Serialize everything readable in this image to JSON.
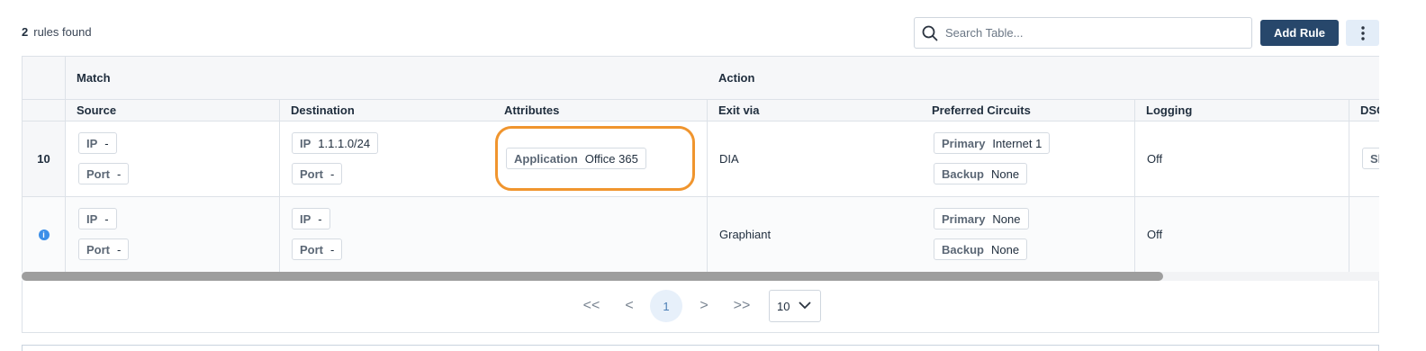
{
  "summary": {
    "count": "2",
    "label": "rules found"
  },
  "toolbar": {
    "search_placeholder": "Search Table...",
    "add_label": "Add Rule"
  },
  "table": {
    "group_headers": {
      "match": "Match",
      "action": "Action"
    },
    "columns": {
      "source": "Source",
      "destination": "Destination",
      "attributes": "Attributes",
      "exit_via": "Exit via",
      "preferred_circuits": "Preferred Circuits",
      "logging": "Logging",
      "dscp": "DSC"
    },
    "rows": [
      {
        "index": "10",
        "source": {
          "ip_key": "IP",
          "ip_val": "-",
          "port_key": "Port",
          "port_val": "-"
        },
        "destination": {
          "ip_key": "IP",
          "ip_val": "1.1.1.0/24",
          "port_key": "Port",
          "port_val": "-"
        },
        "attributes": {
          "key": "Application",
          "val": "Office 365"
        },
        "exit_via": "DIA",
        "circuits": {
          "primary_key": "Primary",
          "primary_val": "Internet 1",
          "backup_key": "Backup",
          "backup_val": "None"
        },
        "logging": "Off",
        "dscp": "Sl"
      },
      {
        "index_icon": "info-icon",
        "source": {
          "ip_key": "IP",
          "ip_val": "-",
          "port_key": "Port",
          "port_val": "-"
        },
        "destination": {
          "ip_key": "IP",
          "ip_val": "-",
          "port_key": "Port",
          "port_val": "-"
        },
        "exit_via": "Graphiant",
        "circuits": {
          "primary_key": "Primary",
          "primary_val": "None",
          "backup_key": "Backup",
          "backup_val": "None"
        },
        "logging": "Off"
      }
    ]
  },
  "pagination": {
    "first": "<<",
    "prev": "<",
    "current": "1",
    "next": ">",
    "last": ">>",
    "page_size": "10"
  },
  "colors": {
    "primary_button": "#27476b",
    "highlight": "#f0952e",
    "info": "#3c8fe8"
  }
}
